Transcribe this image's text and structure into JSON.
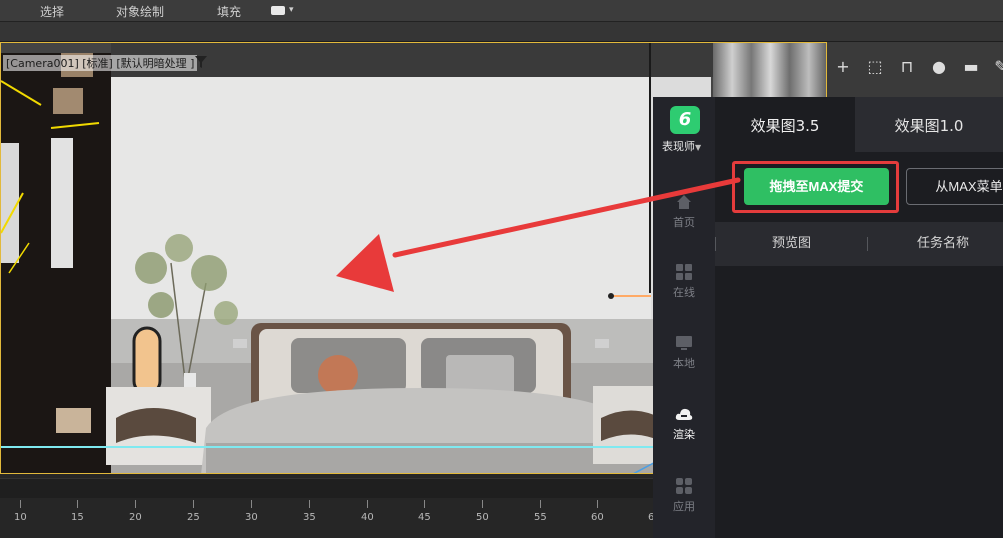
{
  "ribbon": {
    "items": [
      "选择",
      "对象绘制",
      "填充"
    ]
  },
  "viewport": {
    "label": "[Camera001] [标准] [默认明暗处理 ]"
  },
  "timeline": {
    "ticks": [
      "10",
      "15",
      "20",
      "25",
      "30",
      "35",
      "40",
      "45",
      "50",
      "55",
      "60",
      "6"
    ]
  },
  "plugin": {
    "logo_glyph": "6",
    "brand": "表现师",
    "nav": {
      "home": "首页",
      "online": "在线",
      "local": "本地",
      "render": "渲染",
      "apps": "应用"
    },
    "tabs": [
      "效果图3.5",
      "效果图1.0"
    ],
    "submit_button": "拖拽至MAX提交",
    "menu_button": "从MAX菜单提",
    "columns": [
      "预览图",
      "任务名称"
    ]
  },
  "colors": {
    "accent_green": "#2fbf63",
    "highlight_red": "#e43c3c",
    "viewport_border": "#e2b93b"
  }
}
